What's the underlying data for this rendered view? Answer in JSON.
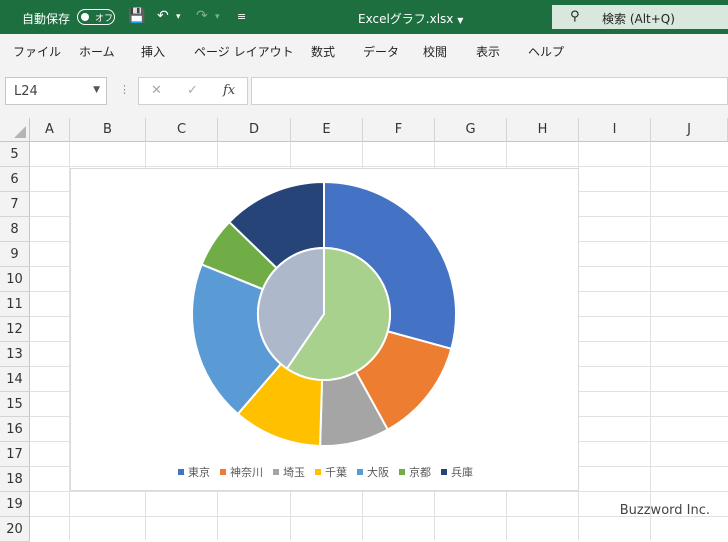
{
  "titlebar": {
    "autosave_label": "自動保存",
    "autosave_state": "オフ",
    "filename": "Excelグラフ.xlsx",
    "search_text": "検索 (Alt+Q)"
  },
  "ribbon": {
    "tabs": [
      "ファイル",
      "ホーム",
      "挿入",
      "ページ レイアウト",
      "数式",
      "データ",
      "校閲",
      "表示",
      "ヘルプ"
    ]
  },
  "formula_bar": {
    "name_box": "L24",
    "cancel": "✕",
    "enter": "✓",
    "fx": "fx",
    "value": ""
  },
  "grid": {
    "columns": [
      "A",
      "B",
      "C",
      "D",
      "E",
      "F",
      "G",
      "H",
      "I",
      "J"
    ],
    "rows": [
      "5",
      "6",
      "7",
      "8",
      "9",
      "10",
      "11",
      "12",
      "13",
      "14",
      "15",
      "16",
      "17",
      "18",
      "19",
      "20"
    ]
  },
  "chart_data": {
    "type": "pie",
    "subtype": "doughnut",
    "title": "",
    "legend_position": "bottom",
    "outer_ring": {
      "categories": [
        "東京",
        "神奈川",
        "埼玉",
        "千葉",
        "大阪",
        "京都",
        "兵庫"
      ],
      "values": [
        31.0,
        13.5,
        9.0,
        11.5,
        21.0,
        6.5,
        13.5
      ],
      "colors": [
        "#4472c4",
        "#ed7d31",
        "#a5a5a5",
        "#ffc000",
        "#5b9bd5",
        "#70ad47",
        "#264478"
      ]
    },
    "inner_ring": {
      "values": [
        59.5,
        40.5
      ],
      "colors": [
        "#a9d18e",
        "#adb9ca"
      ]
    },
    "legend": [
      {
        "name": "東京",
        "color": "#4472c4"
      },
      {
        "name": "神奈川",
        "color": "#ed7d31"
      },
      {
        "name": "埼玉",
        "color": "#a5a5a5"
      },
      {
        "name": "千葉",
        "color": "#ffc000"
      },
      {
        "name": "大阪",
        "color": "#5b9bd5"
      },
      {
        "name": "京都",
        "color": "#70ad47"
      },
      {
        "name": "兵庫",
        "color": "#264478"
      }
    ]
  },
  "watermark": "Buzzword Inc."
}
